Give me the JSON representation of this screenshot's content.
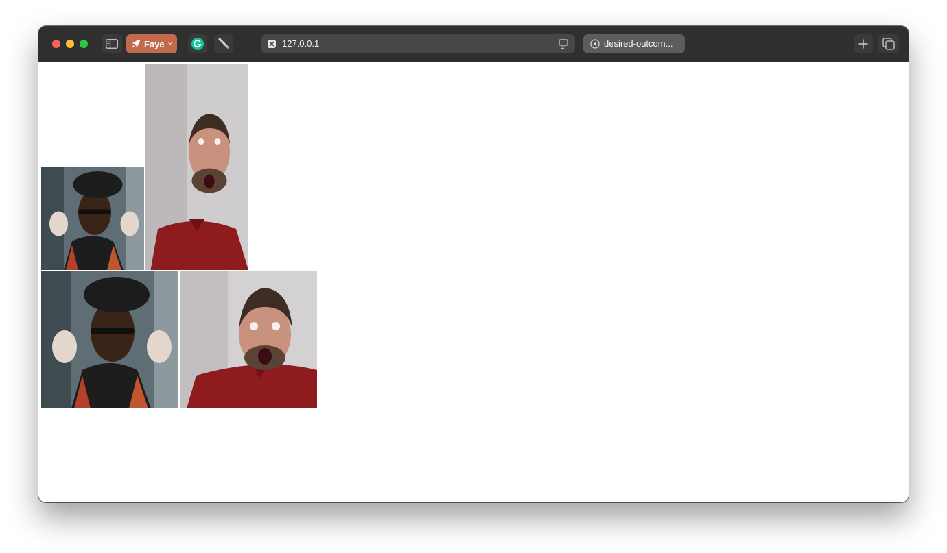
{
  "browser": {
    "profile_name": "Faye",
    "address_bar": {
      "url": "127.0.0.1"
    },
    "other_tab": {
      "title": "desired-outcom..."
    }
  },
  "icons": {
    "sidebar": "sidebar-icon",
    "profile": "rocket-icon",
    "grammarly": "grammarly-icon",
    "tool": "pen-tool-icon",
    "site": "close-square-icon",
    "reader": "reader-mode-icon",
    "tab": "compass-icon",
    "new_tab": "plus-icon",
    "tab_overview": "tab-overview-icon"
  },
  "colors": {
    "toolbar": "#2f2f2f",
    "profile_button": "#c26a4e",
    "page_background": "#ffffff"
  },
  "page": {
    "images": [
      {
        "name": "woman-sunglasses-photo-small"
      },
      {
        "name": "surprised-man-photo-tall"
      },
      {
        "name": "woman-sunglasses-photo-square"
      },
      {
        "name": "surprised-man-photo-square"
      }
    ]
  }
}
